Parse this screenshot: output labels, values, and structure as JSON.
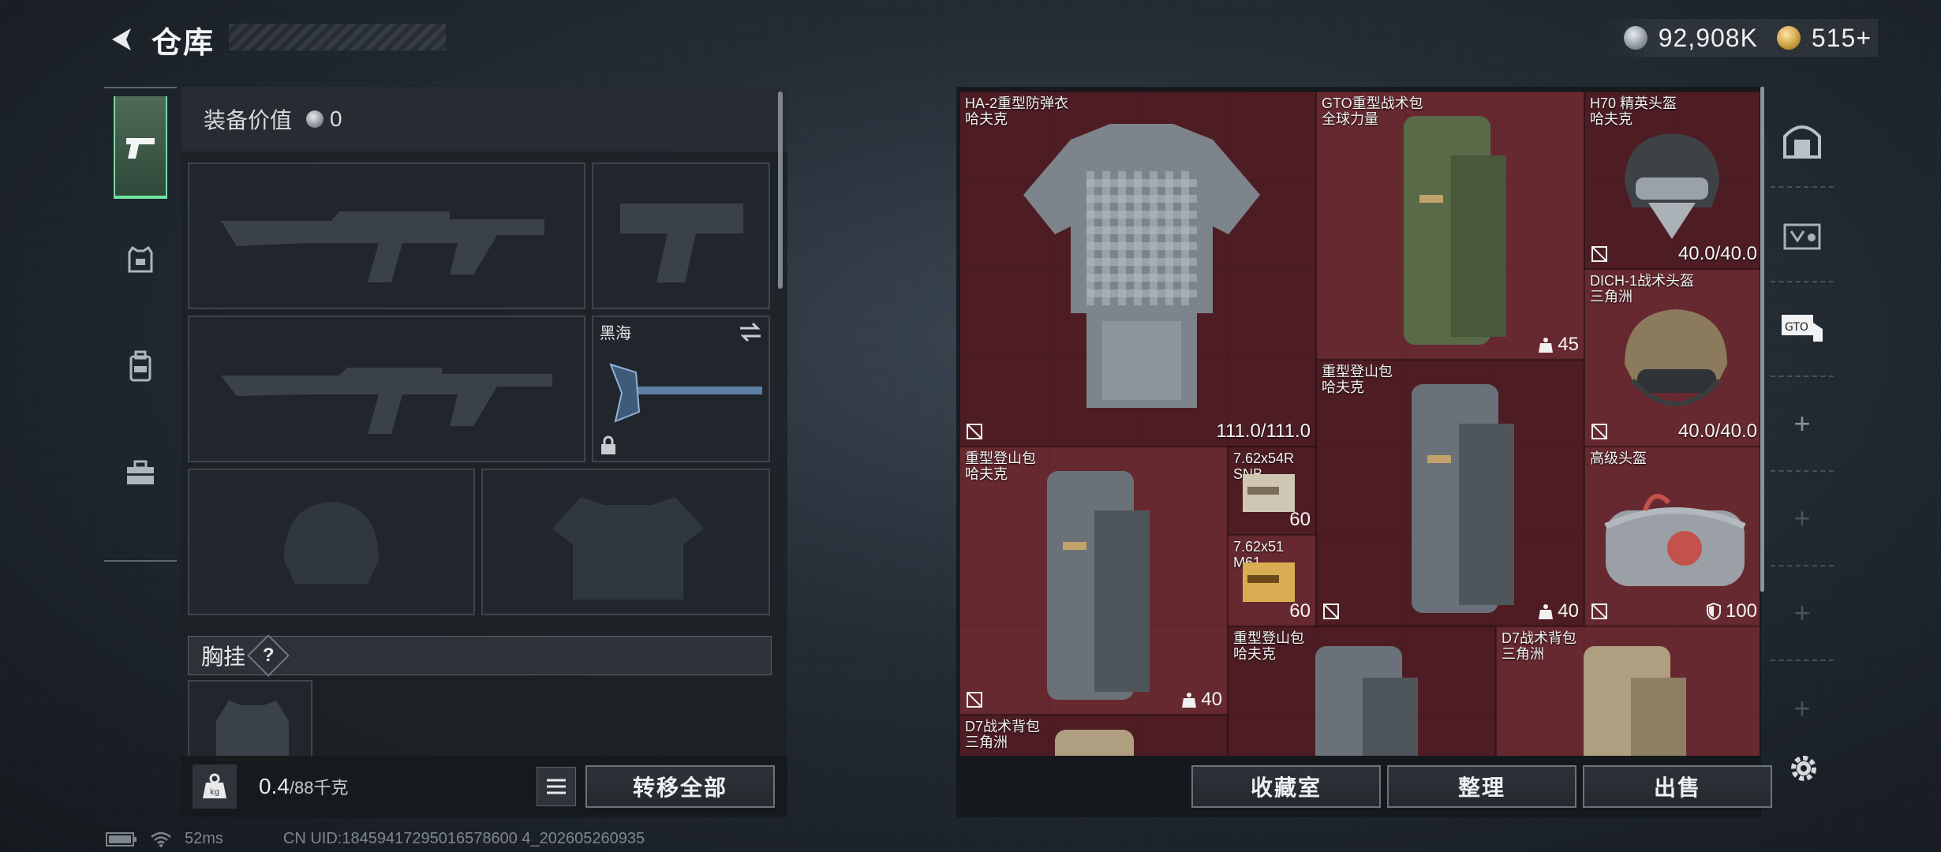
{
  "header": {
    "title": "仓库"
  },
  "currency": {
    "silver": {
      "value": "92,908K"
    },
    "gold": {
      "value": "515+"
    }
  },
  "left_rail": {
    "items": [
      "pistol-icon",
      "vest-armor-icon",
      "backpack-icon",
      "toolbox-icon"
    ],
    "active": 0
  },
  "equipment": {
    "value_label": "装备价值",
    "value": "0",
    "melee": {
      "label": "黑海"
    },
    "chest_rig_label": "胸挂",
    "help": "?",
    "weight": "0.4",
    "weight_max": "/88千克",
    "transfer_all": "转移全部"
  },
  "inventory": {
    "items": [
      {
        "name": "HA-2重型防弹衣",
        "brand": "哈夫克",
        "durability": "111.0/111.0"
      },
      {
        "name": "GTO重型战术包",
        "brand": "全球力量",
        "capacity": "45"
      },
      {
        "name": "H70 精英头盔",
        "brand": "哈夫克",
        "durability": "40.0/40.0"
      },
      {
        "name": "DICH-1战术头盔",
        "brand": "三角洲",
        "durability": "40.0/40.0"
      },
      {
        "name": "重型登山包",
        "brand": "哈夫克",
        "capacity": "40"
      },
      {
        "name": "重型登山包",
        "brand": "哈夫克",
        "capacity": "40"
      },
      {
        "name": "7.62x54R SNB",
        "brand": "",
        "qty": "60"
      },
      {
        "name": "7.62x51 M61",
        "brand": "",
        "qty": "60"
      },
      {
        "name": "高级头盔",
        "brand": "",
        "durability": "100"
      },
      {
        "name": "重型登山包",
        "brand": "哈夫克"
      },
      {
        "name": "D7战术背包",
        "brand": "三角洲"
      },
      {
        "name": "D7战术背包",
        "brand": "三角洲"
      }
    ],
    "buttons": {
      "vault": "收藏室",
      "sort": "整理",
      "sell": "出售"
    }
  },
  "status_bar": {
    "ping": "52ms",
    "uid": "CN UID:18459417295016578600 4_202605260935"
  }
}
